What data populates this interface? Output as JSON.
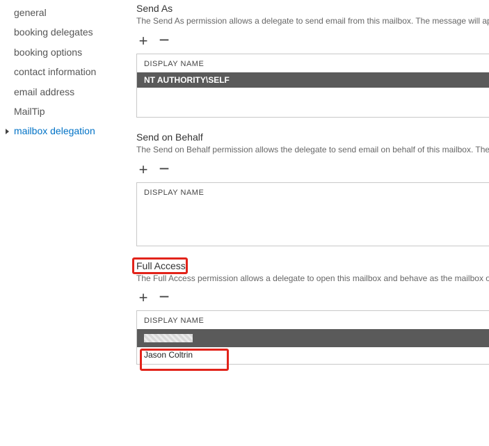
{
  "sidebar": {
    "items": [
      {
        "label": "general"
      },
      {
        "label": "booking delegates"
      },
      {
        "label": "booking options"
      },
      {
        "label": "contact information"
      },
      {
        "label": "email address"
      },
      {
        "label": "MailTip"
      },
      {
        "label": "mailbox delegation"
      }
    ]
  },
  "sections": {
    "sendAs": {
      "title": "Send As",
      "desc": "The Send As permission allows a delegate to send email from this mailbox. The message will ap",
      "columnHeader": "DISPLAY NAME",
      "rows": [
        "NT AUTHORITY\\SELF"
      ]
    },
    "sendOnBehalf": {
      "title": "Send on Behalf",
      "desc": "The Send on Behalf permission allows the delegate to send email on behalf of this mailbox. The",
      "columnHeader": "DISPLAY NAME",
      "rows": []
    },
    "fullAccess": {
      "title": "Full Access",
      "desc": "The Full Access permission allows a delegate to open this mailbox and behave as the mailbox o",
      "columnHeader": "DISPLAY NAME",
      "rows": [
        "Jason Coltrin"
      ]
    }
  },
  "icons": {
    "plus": "+",
    "minus": "−"
  }
}
